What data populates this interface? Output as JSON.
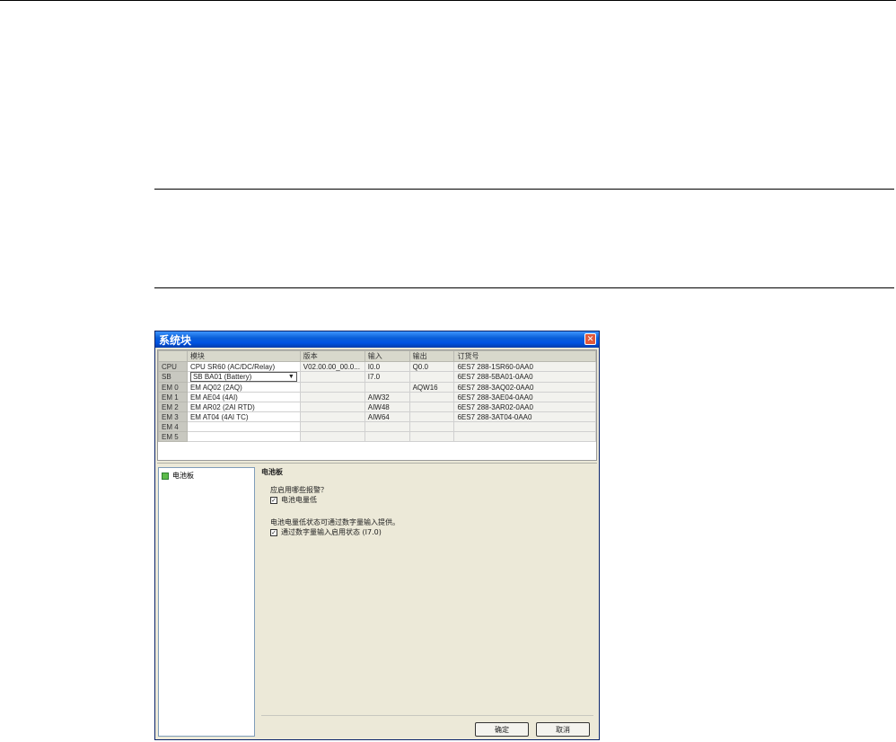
{
  "window": {
    "title": "系统块",
    "close_glyph": "✕"
  },
  "grid": {
    "headers": [
      "",
      "模块",
      "版本",
      "输入",
      "输出",
      "订货号"
    ],
    "rows": [
      {
        "slot": "CPU",
        "module": "CPU SR60 (AC/DC/Relay)",
        "version": "V02.00.00_00.0...",
        "input": "I0.0",
        "output": "Q0.0",
        "order": "6ES7 288-1SR60-0AA0"
      },
      {
        "slot": "SB",
        "module": "SB BA01 (Battery)",
        "version": "",
        "input": "I7.0",
        "output": "",
        "order": "6ES7 288-5BA01-0AA0"
      },
      {
        "slot": "EM 0",
        "module": "EM AQ02 (2AQ)",
        "version": "",
        "input": "",
        "output": "AQW16",
        "order": "6ES7 288-3AQ02-0AA0"
      },
      {
        "slot": "EM 1",
        "module": "EM AE04 (4AI)",
        "version": "",
        "input": "AIW32",
        "output": "",
        "order": "6ES7 288-3AE04-0AA0"
      },
      {
        "slot": "EM 2",
        "module": "EM AR02 (2AI RTD)",
        "version": "",
        "input": "AIW48",
        "output": "",
        "order": "6ES7 288-3AR02-0AA0"
      },
      {
        "slot": "EM 3",
        "module": "EM AT04 (4AI TC)",
        "version": "",
        "input": "AIW64",
        "output": "",
        "order": "6ES7 288-3AT04-0AA0"
      },
      {
        "slot": "EM 4",
        "module": "",
        "version": "",
        "input": "",
        "output": "",
        "order": ""
      },
      {
        "slot": "EM 5",
        "module": "",
        "version": "",
        "input": "",
        "output": "",
        "order": ""
      }
    ]
  },
  "tree": {
    "items": [
      {
        "label": "电池板"
      }
    ]
  },
  "panel": {
    "heading": "电池板",
    "question": "应启用哪些报警？",
    "cb1_label": "电池电量低",
    "info": "电池电量低状态可通过数字量输入提供。",
    "cb2_label": "通过数字量输入启用状态 (I7.0)",
    "check_glyph": "✓"
  },
  "buttons": {
    "ok": "确定",
    "cancel": "取消"
  }
}
